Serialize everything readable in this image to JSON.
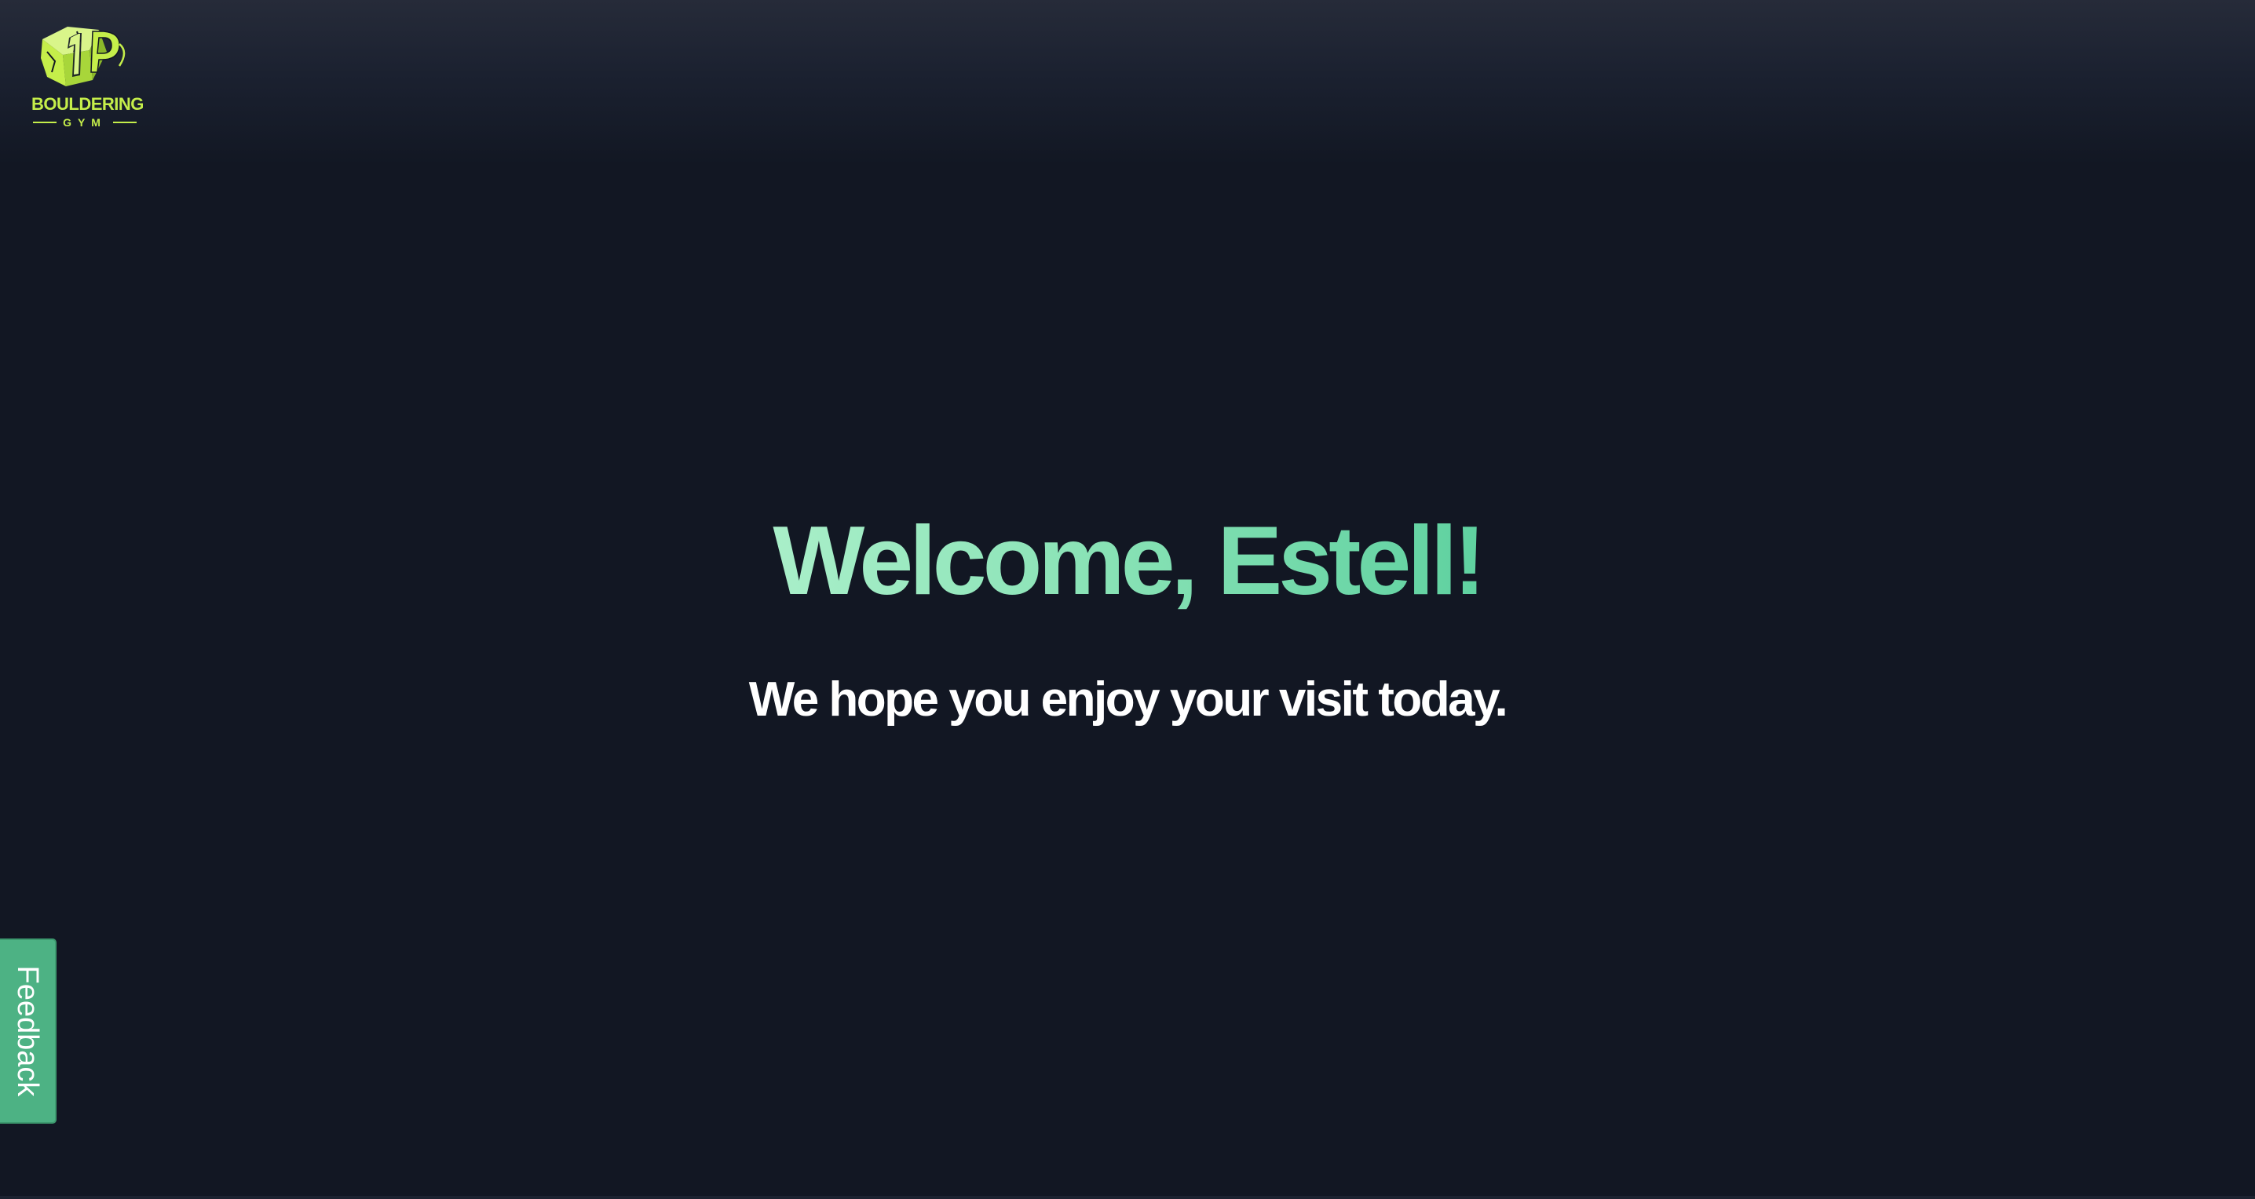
{
  "logo": {
    "name": "BOULDERING",
    "sub": "GYM",
    "icon": "boulder-1p-logo-icon",
    "color": "#c5ee4a"
  },
  "main": {
    "welcome": "Welcome, Estell!",
    "subtitle": "We hope you enjoy your visit today."
  },
  "feedback": {
    "label": "Feedback",
    "color": "#4db284"
  },
  "colors": {
    "background": "#121723",
    "accent": "#86e1b4",
    "text": "#ffffff"
  }
}
